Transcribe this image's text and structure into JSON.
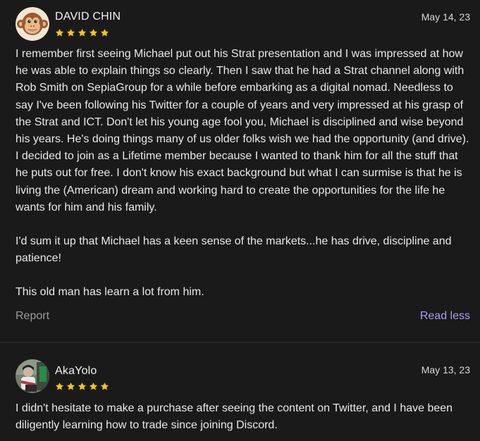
{
  "colors": {
    "background": "#1a1a1a",
    "star": "#f5c518",
    "link": "#a79cf0",
    "muted": "#9a9a9a"
  },
  "reviews": [
    {
      "author": "DAVID CHIN",
      "avatar": "monkey-avatar",
      "rating": 5,
      "date": "May 14, 23",
      "paragraphs": [
        "I remember first seeing Michael put out his Strat presentation and I was impressed at how he was able to explain things so clearly. Then I saw that he had a Strat channel along with Rob Smith on SepiaGroup for a while before embarking as a digital nomad. Needless to say I've been following his Twitter for a couple of years and very impressed at his grasp of the Strat and ICT. Don't let his young age fool you, Michael is disciplined and wise beyond his years. He's doing things many of us older folks wish we had the opportunity (and drive). I decided to join as a Lifetime member because I wanted to thank him for all the stuff that he puts out for free. I don't know his exact background but what I can surmise is that he is living the (American) dream and working hard to create the opportunities for the life he wants for him and his family.",
        "I'd sum it up that Michael has a keen sense of the markets...he has drive, discipline and patience!",
        "This old man has learn a lot from him."
      ],
      "report_label": "Report",
      "toggle_label": "Read less"
    },
    {
      "author": "AkaYolo",
      "avatar": "photo-avatar",
      "rating": 5,
      "date": "May 13, 23",
      "paragraphs": [
        "I didn't hesitate to make a purchase after seeing the content on Twitter, and I have been diligently learning how to trade since joining Discord."
      ]
    }
  ]
}
